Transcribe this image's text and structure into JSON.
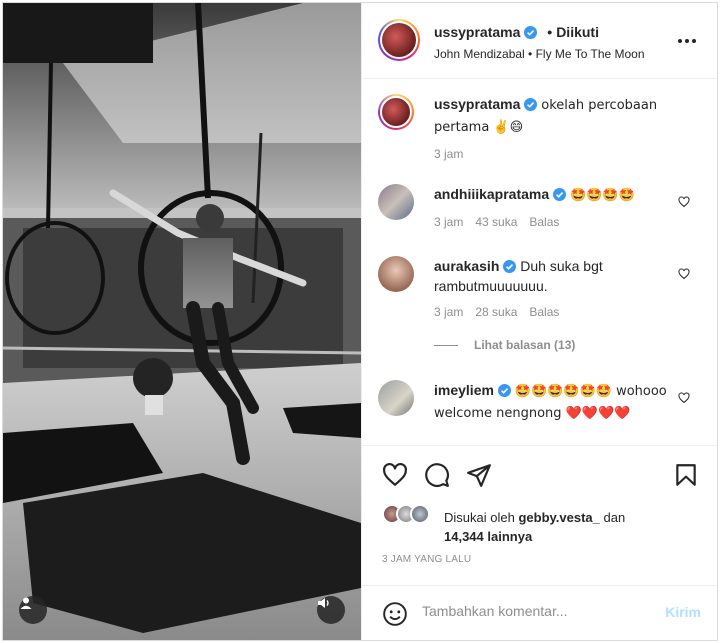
{
  "post": {
    "username": "ussypratama",
    "follow_separator": "•",
    "follow_status": "Diikuti",
    "music": "John Mendizabal • Fly Me To The Moon",
    "caption": "okelah percobaan pertama ✌️😄",
    "caption_time": "3 jam"
  },
  "comments": [
    {
      "username": "andhiiikapratama",
      "text": "🤩🤩🤩🤩",
      "time": "3 jam",
      "likes": "43 suka",
      "reply": "Balas"
    },
    {
      "username": "aurakasih",
      "text": "Duh suka bgt rambutmuuuuuuu.",
      "time": "3 jam",
      "likes": "28 suka",
      "reply": "Balas"
    },
    {
      "username": "imeyliem",
      "text": "🤩🤩🤩🤩🤩🤩 wohooo welcome nengnong ❤️❤️❤️❤️"
    }
  ],
  "view_replies": "Lihat balasan (13)",
  "likes": {
    "prefix": "Disukai oleh",
    "user": "gebby.vesta_",
    "connector": "dan",
    "count": "14,344 lainnya"
  },
  "time_ago": "3 JAM YANG LALU",
  "composer": {
    "placeholder": "Tambahkan komentar...",
    "post_label": "Kirim"
  },
  "icons": {
    "more": "more-options-icon",
    "like": "heart-icon",
    "comment": "comment-icon",
    "share": "share-icon",
    "save": "bookmark-icon",
    "emoji": "emoji-icon",
    "user_tag": "user-tag-icon",
    "sound": "volume-icon"
  },
  "colors": {
    "verified": "#3897f0",
    "post_button_disabled": "#b2dffc",
    "muted_text": "#8e8e8e"
  }
}
